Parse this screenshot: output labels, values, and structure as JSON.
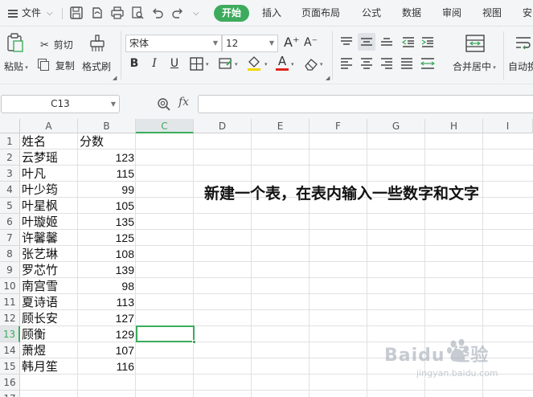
{
  "menubar": {
    "file_label": "文件",
    "tabs": [
      "开始",
      "插入",
      "页面布局",
      "公式",
      "数据",
      "审阅",
      "视图",
      "安"
    ],
    "active_tab": "开始",
    "accent_color": "#3dab5d"
  },
  "ribbon": {
    "paste_label": "粘贴",
    "cut_label": "剪切",
    "copy_label": "复制",
    "format_painter_label": "格式刷",
    "font_name": "宋体",
    "font_size": "12",
    "bold_label": "B",
    "italic_label": "I",
    "underline_label": "U",
    "font_grow_label": "A⁺",
    "font_shrink_label": "A⁻",
    "merge_label": "合并居中",
    "autowrap_label": "自动换"
  },
  "formula_bar": {
    "cell_ref": "C13",
    "fx_label": "fx",
    "formula_value": ""
  },
  "grid": {
    "columns": [
      "A",
      "B",
      "C",
      "D",
      "E",
      "F",
      "G",
      "H",
      "I"
    ],
    "selected_column": "C",
    "rows": [
      "1",
      "2",
      "3",
      "4",
      "5",
      "6",
      "7",
      "8",
      "9",
      "10",
      "11",
      "12",
      "13",
      "14",
      "15",
      "16",
      "17"
    ],
    "selected_row": "13",
    "header": {
      "name": "姓名",
      "score": "分数"
    },
    "data": [
      {
        "name": "云梦瑶",
        "score": "123"
      },
      {
        "name": "叶凡",
        "score": "115"
      },
      {
        "name": "叶少筠",
        "score": "99"
      },
      {
        "name": "叶星枫",
        "score": "105"
      },
      {
        "name": "叶璇姬",
        "score": "135"
      },
      {
        "name": "许馨馨",
        "score": "125"
      },
      {
        "name": "张艺琳",
        "score": "108"
      },
      {
        "name": "罗芯竹",
        "score": "139"
      },
      {
        "name": "南宫雪",
        "score": "98"
      },
      {
        "name": "夏诗语",
        "score": "113"
      },
      {
        "name": "顾长安",
        "score": "127"
      },
      {
        "name": "顾衡",
        "score": "129"
      },
      {
        "name": "萧煜",
        "score": "107"
      },
      {
        "name": "韩月笙",
        "score": "116"
      }
    ],
    "note": "新建一个表，在表内输入一些数字和文字"
  },
  "watermark": {
    "text": "Baidu 经验",
    "sub": "jingyan.baidu.com"
  }
}
